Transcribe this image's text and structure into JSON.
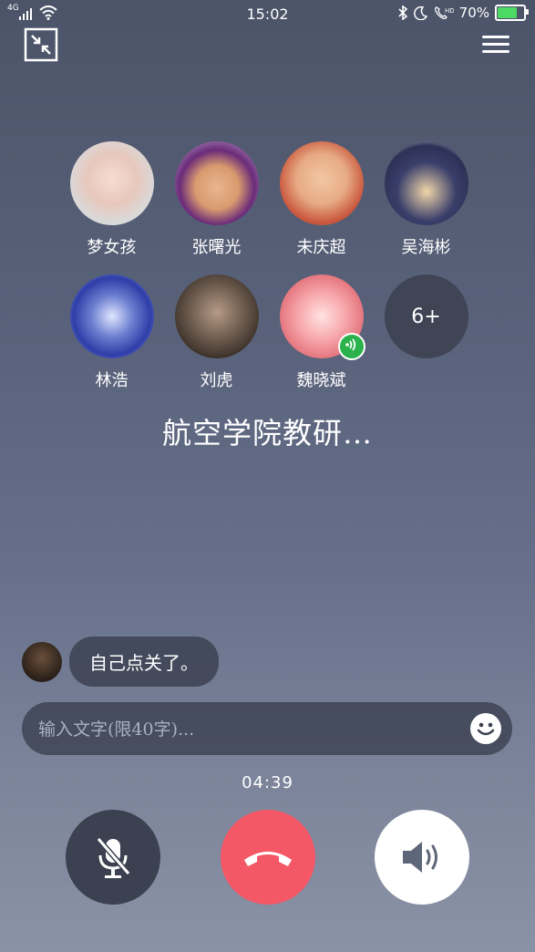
{
  "status_bar": {
    "network": "4G",
    "time": "15:02",
    "battery": "70%"
  },
  "members": [
    {
      "name": "梦女孩"
    },
    {
      "name": "张曙光"
    },
    {
      "name": "未庆超"
    },
    {
      "name": "吴海彬"
    },
    {
      "name": "林浩"
    },
    {
      "name": "刘虎"
    },
    {
      "name": "魏晓斌"
    }
  ],
  "more_members": "6+",
  "group_name": "航空学院教研…",
  "chat": {
    "last_message": "自己点关了。"
  },
  "input": {
    "placeholder": "输入文字(限40字)..."
  },
  "call": {
    "duration": "04:39"
  },
  "colors": {
    "hangup": "#f45867",
    "speaking": "#2bb24c",
    "battery": "#4cd964"
  }
}
